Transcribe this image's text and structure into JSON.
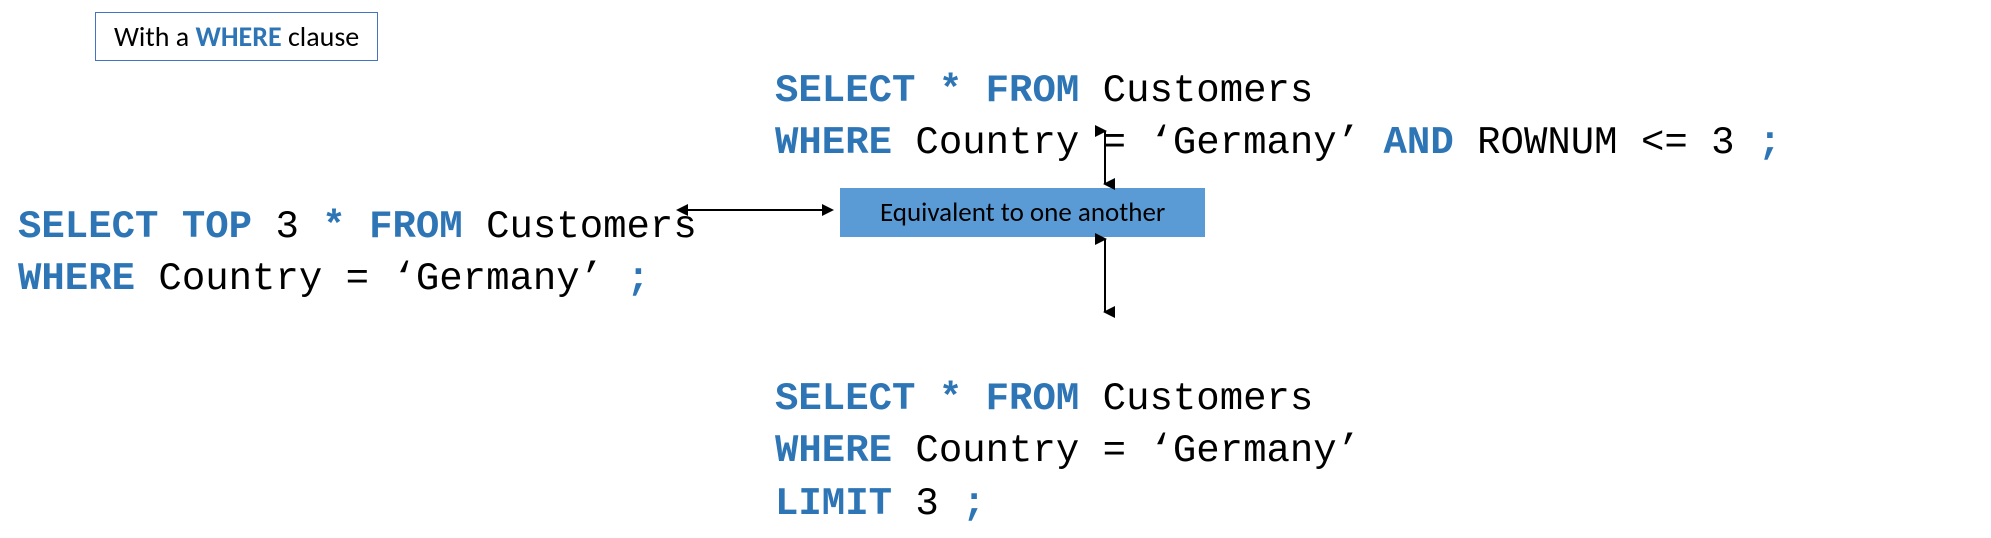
{
  "header": {
    "prefix": "With a ",
    "keyword": "WHERE",
    "suffix": " clause"
  },
  "code_left": {
    "l1": {
      "kw1": "SELECT TOP",
      "txt1": " 3 ",
      "kw2": "*",
      "txt2": " ",
      "kw3": "FROM",
      "txt3": " Customers"
    },
    "l2": {
      "kw1": "WHERE",
      "txt1": " Country = ‘Germany’ ",
      "kw2": ";"
    }
  },
  "code_top": {
    "l1": {
      "kw1": "SELECT *",
      "txt1": " ",
      "kw2": "FROM",
      "txt2": " Customers"
    },
    "l2": {
      "kw1": "WHERE",
      "txt1": " Country = ‘Germany’ ",
      "kw2": "AND",
      "txt2": " ROWNUM <= 3 ",
      "kw3": ";"
    }
  },
  "code_bottom": {
    "l1": {
      "kw1": "SELECT *",
      "txt1": " ",
      "kw2": "FROM",
      "txt2": " Customers"
    },
    "l2": {
      "kw1": "WHERE",
      "txt1": " Country = ‘Germany’"
    },
    "l3": {
      "kw1": "LIMIT",
      "txt1": " 3 ",
      "kw2": ";"
    }
  },
  "equiv_label": "Equivalent to one another"
}
